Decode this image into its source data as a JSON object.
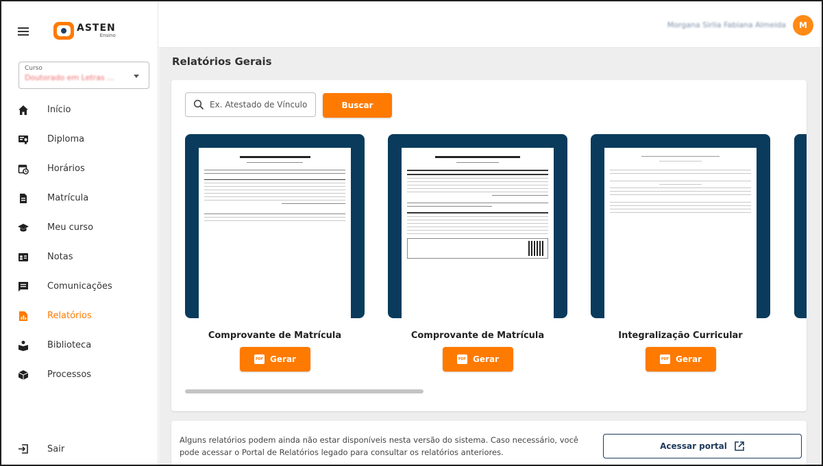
{
  "app": {
    "logo_name": "ASTEN",
    "logo_sub": "Ensino"
  },
  "user": {
    "name": "Morgana Sirlia Fabiana Almeida",
    "initial": "M"
  },
  "course": {
    "label": "Curso",
    "value": "Doutorado em Letras ..."
  },
  "nav": {
    "items": [
      {
        "label": "Início",
        "icon": "home-icon"
      },
      {
        "label": "Diploma",
        "icon": "diploma-icon"
      },
      {
        "label": "Horários",
        "icon": "schedule-icon"
      },
      {
        "label": "Matrícula",
        "icon": "document-icon"
      },
      {
        "label": "Meu curso",
        "icon": "graduation-cap-icon"
      },
      {
        "label": "Notas",
        "icon": "grades-icon"
      },
      {
        "label": "Comunicações",
        "icon": "messages-icon"
      },
      {
        "label": "Relatórios",
        "icon": "reports-icon",
        "active": true
      },
      {
        "label": "Biblioteca",
        "icon": "library-icon"
      },
      {
        "label": "Processos",
        "icon": "process-icon"
      }
    ],
    "logout_label": "Sair"
  },
  "page": {
    "title": "Relatórios Gerais"
  },
  "search": {
    "placeholder": "Ex. Atestado de Vínculo",
    "button_label": "Buscar"
  },
  "reports": [
    {
      "title": "Comprovante de Matrícula",
      "button_label": "Gerar",
      "pdf_label": "PDF"
    },
    {
      "title": "Comprovante de Matrícula",
      "button_label": "Gerar",
      "pdf_label": "PDF"
    },
    {
      "title": "Integralização Curricular",
      "button_label": "Gerar",
      "pdf_label": "PDF"
    }
  ],
  "footer": {
    "text": "Alguns relatórios podem ainda não estar disponíveis nesta versão do sistema. Caso necessário, você pode acessar o Portal de Relatórios legado para consultar os relatórios anteriores.",
    "button_label": "Acessar portal"
  },
  "colors": {
    "accent": "#ff7a00",
    "navy": "#0a3b5c",
    "background": "#eeeeee"
  }
}
